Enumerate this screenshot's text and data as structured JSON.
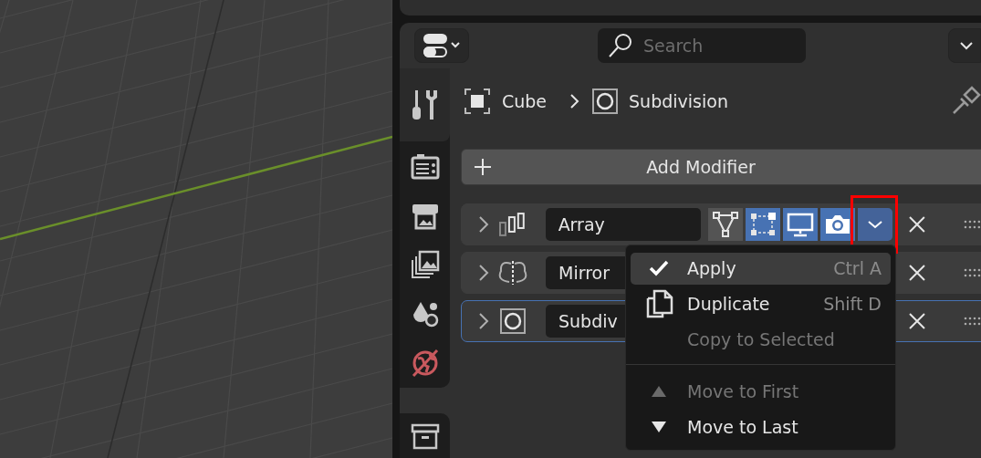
{
  "header": {
    "search": {
      "placeholder": "Search"
    }
  },
  "sidebar": {
    "tabs": [
      {
        "kind": "tool",
        "selected": true
      },
      {
        "kind": "render",
        "selected": false
      },
      {
        "kind": "output",
        "selected": false
      },
      {
        "kind": "view_layer",
        "selected": false
      },
      {
        "kind": "scene",
        "selected": false
      },
      {
        "kind": "world",
        "selected": false
      },
      {
        "kind": "collection",
        "selected": false
      }
    ]
  },
  "breadcrumb": [
    {
      "kind": "object",
      "text": "Cube"
    },
    {
      "kind": "modifier",
      "text": "Subdivision"
    }
  ],
  "add_modifier": {
    "label": "Add Modifier"
  },
  "modifiers": [
    {
      "kind": "array",
      "name": "Array",
      "selected": false,
      "expanded": false,
      "toggles": [
        {
          "kind": "on_cage",
          "on": false
        },
        {
          "kind": "edit_mode",
          "on": true
        },
        {
          "kind": "viewport",
          "on": true
        },
        {
          "kind": "render",
          "on": true
        }
      ],
      "menu_button": {
        "open": true,
        "highlighted": true
      }
    },
    {
      "kind": "mirror",
      "name": "Mirror",
      "selected": false,
      "expanded": false
    },
    {
      "kind": "subdivision",
      "name": "Subdiv",
      "selected": true,
      "expanded": false
    }
  ],
  "menu": [
    {
      "kind": "check",
      "label": "Apply",
      "shortcut": "Ctrl A",
      "disabled": false,
      "selected": true
    },
    {
      "kind": "copy",
      "label": "Duplicate",
      "shortcut": "Shift D",
      "disabled": false,
      "selected": false
    },
    {
      "kind": "none",
      "label": "Copy to Selected",
      "disabled": true,
      "selected": false
    },
    {
      "kind": "separator"
    },
    {
      "kind": "up",
      "label": "Move to First",
      "disabled": true,
      "selected": false
    },
    {
      "kind": "down",
      "label": "Move to Last",
      "disabled": false,
      "selected": false
    }
  ]
}
